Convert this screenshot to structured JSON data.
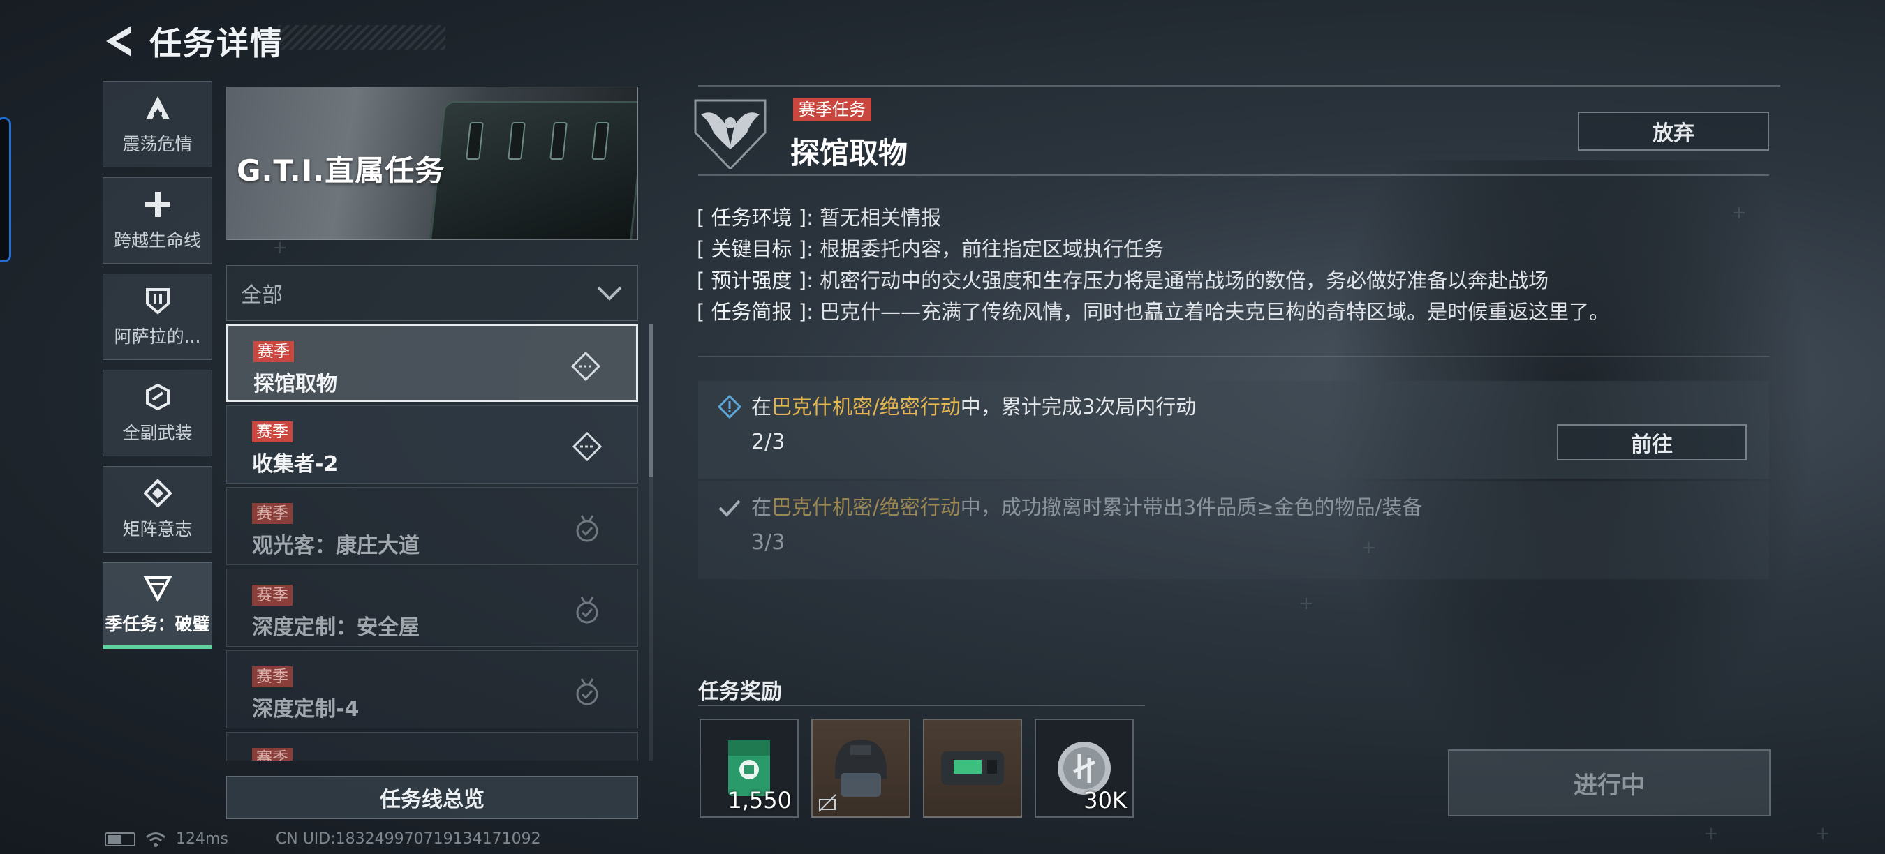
{
  "header": {
    "title": "任务详情"
  },
  "categories": [
    {
      "label": "震荡危情",
      "icon": "triangle-a-icon"
    },
    {
      "label": "跨越生命线",
      "icon": "plus-icon"
    },
    {
      "label": "阿萨拉的...",
      "icon": "shield-icon"
    },
    {
      "label": "全副武装",
      "icon": "hexagon-icon"
    },
    {
      "label": "矩阵意志",
      "icon": "diamond-icon"
    },
    {
      "label": "季任务：破璧",
      "icon": "funnel-icon",
      "active": true
    }
  ],
  "banner": {
    "title": "G.T.I.直属任务"
  },
  "filter": {
    "value": "全部"
  },
  "tasks": [
    {
      "tag": "赛季",
      "name": "探馆取物",
      "status": "in-progress",
      "selected": true
    },
    {
      "tag": "赛季",
      "name": "收集者-2",
      "status": "in-progress"
    },
    {
      "tag": "赛季",
      "name": "观光客：康庄大道",
      "status": "completed"
    },
    {
      "tag": "赛季",
      "name": "深度定制：安全屋",
      "status": "completed"
    },
    {
      "tag": "赛季",
      "name": "深度定制-4",
      "status": "completed"
    },
    {
      "tag": "赛季",
      "name": "",
      "status": "completed"
    }
  ],
  "overview_button": "任务线总览",
  "status_bar": {
    "ping": "124ms",
    "uid": "CN UID:183249970719134171092"
  },
  "detail": {
    "season_tag": "赛季任务",
    "title": "探馆取物",
    "abandon_button": "放弃",
    "info": [
      {
        "key": "[ 任务环境 ]",
        "value": "暂无相关情报"
      },
      {
        "key": "[ 关键目标 ]",
        "value": "根据委托内容，前往指定区域执行任务"
      },
      {
        "key": "[ 预计强度 ]",
        "value": "机密行动中的交火强度和生存压力将是通常战场的数倍，务必做好准备以奔赴战场"
      },
      {
        "key": "[ 任务简报 ]",
        "value": "巴克什——充满了传统风情，同时也矗立着哈夫克巨构的奇特区域。是时候重返这里了。"
      }
    ],
    "objectives": [
      {
        "pre": "在",
        "highlight": "巴克什机密/绝密行动",
        "post": "中，累计完成3次局内行动",
        "progress": "2/3",
        "done": false
      },
      {
        "pre": "在",
        "highlight": "巴克什机密/绝密行动",
        "post": "中，成功撤离时累计带出3件品质≥金色的物品/装备",
        "progress": "3/3",
        "done": true
      }
    ],
    "goto_button": "前往",
    "reward_title": "任务奖励",
    "rewards": [
      {
        "icon": "green-crate-icon",
        "qty": "1,550"
      },
      {
        "icon": "helmet-icon",
        "qty": ""
      },
      {
        "icon": "device-icon",
        "qty": ""
      },
      {
        "icon": "silver-coin-icon",
        "qty": "30K"
      }
    ],
    "status_button": "进行中"
  },
  "colors": {
    "season_red": "#c9473f",
    "highlight_gold": "#e3b64f",
    "active_green": "#5fd0a0"
  }
}
